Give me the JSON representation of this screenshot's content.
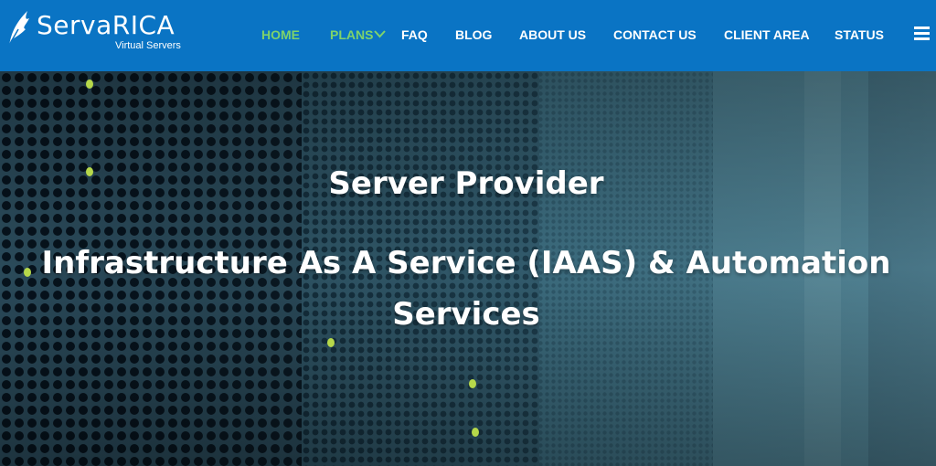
{
  "brand": {
    "name": "ServaRICA",
    "tagline": "Virtual Servers",
    "colors": {
      "header_bg": "#0a74c4",
      "nav_active": "#7ed36b",
      "nav_text": "#ffffff"
    }
  },
  "nav": {
    "items": [
      {
        "label": "HOME",
        "active": true
      },
      {
        "label": "PLANS",
        "active": false,
        "has_dropdown": true
      },
      {
        "label": "FAQ",
        "active": false
      },
      {
        "label": "BLOG",
        "active": false
      },
      {
        "label": "ABOUT US",
        "active": false
      },
      {
        "label": "CONTACT US",
        "active": false
      },
      {
        "label": "CLIENT AREA",
        "active": false
      },
      {
        "label": "STATUS",
        "active": false
      }
    ],
    "menu_icon": "hamburger-icon"
  },
  "hero": {
    "title": "Server Provider",
    "subtitle": "Infrastructure As A Service (IAAS) & Automation Services"
  }
}
